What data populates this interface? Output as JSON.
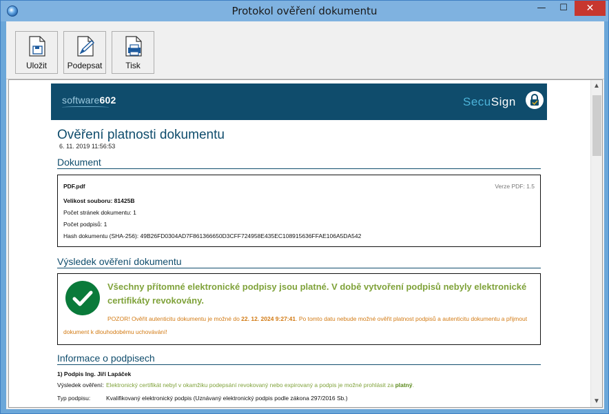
{
  "window": {
    "title": "Protokol ověření dokumentu",
    "minimize": "—",
    "maximize": "☐",
    "close": "✕"
  },
  "toolbar": {
    "save_label": "Uložit",
    "sign_label": "Podepsat",
    "print_label": "Tisk"
  },
  "banner": {
    "left_logo_prefix": "software",
    "left_logo_suffix": "602",
    "right_logo_prefix": "Secu",
    "right_logo_suffix": "Sign"
  },
  "report": {
    "title": "Ověření platnosti dokumentu",
    "date": "6. 11. 2019 11:56:53"
  },
  "document": {
    "heading": "Dokument",
    "file_name": "PDF.pdf",
    "pdf_version": "Verze PDF: 1.5",
    "size": "Velikost souboru: 81425B",
    "pages": "Počet stránek dokumentu: 1",
    "signatures": "Počet podpisů: 1",
    "hash": "Hash dokumentu (SHA-256): 49B26FD0304AD7F861366650D3CFF724958E435EC108915636FFAE106A5DA542"
  },
  "result": {
    "heading": "Výsledek ověření dokumentu",
    "message_line1": "Všechny přítomné elektronické podpisy jsou platné. V době vytvoření podpisů nebyly elektronické",
    "message_line2": "certifikáty revokovány.",
    "warning_prefix": "POZOR! Ověřit autenticitu dokumentu je možné do ",
    "warning_date": "22. 12. 2024 9:27:41",
    "warning_suffix": ". Po tomto datu nebude možné ověřit platnost podpisů a autenticitu dokumentu a přijmout",
    "warning_line2": "dokument k dlouhodobému uchovávání!"
  },
  "signatures_info": {
    "heading": "Informace o podpisech",
    "signature_title": "1) Podpis Ing. Jiří Lapáček",
    "verify_label": "Výsledek ověření:",
    "verify_text": "Elektronický certifikát nebyl v okamžiku podepsání revokovaný nebo expirovaný a podpis je možné prohlásit za ",
    "verify_status": "platný",
    "verify_end": ".",
    "type_label": "Typ podpisu:",
    "type_text": "Kvalifikovaný elektronický podpis (Uznávaný elektronický podpis podle zákona 297/2016 Sb.)"
  },
  "colors": {
    "accent": "#0f4c6c",
    "success": "#7fa23a",
    "warning": "#d27a13",
    "check_circle": "#0a7a3a"
  },
  "icons": [
    "app-icon",
    "save-icon",
    "sign-icon",
    "print-icon",
    "lock-icon",
    "checkmark-icon"
  ]
}
